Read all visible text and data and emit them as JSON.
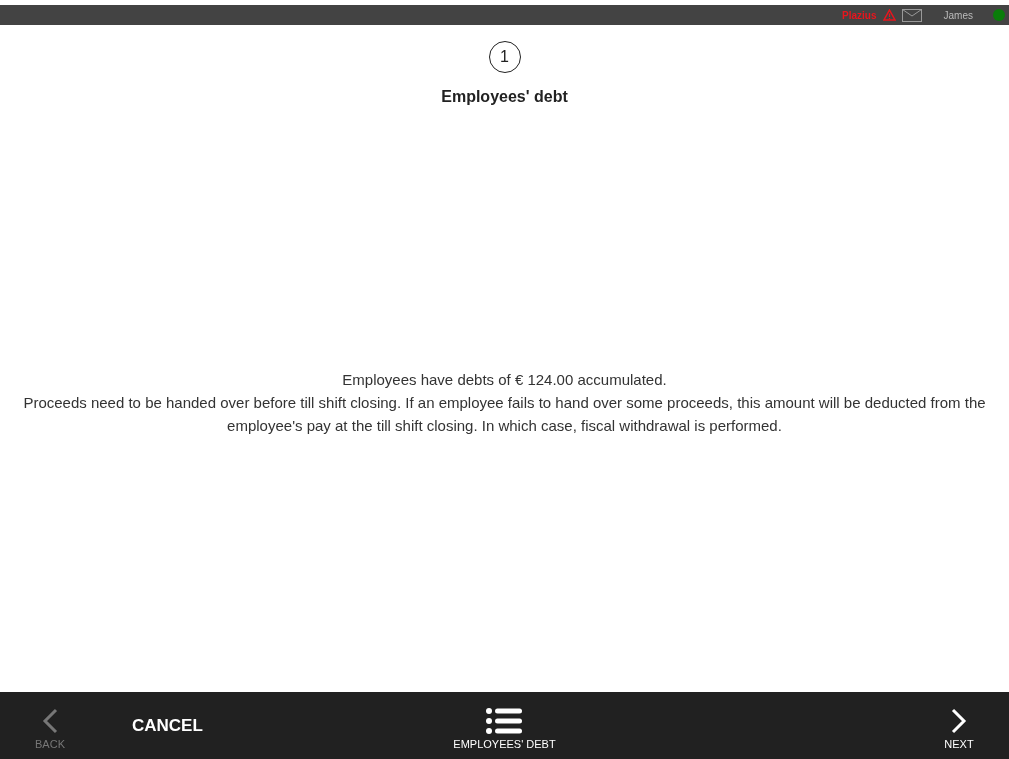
{
  "top_bar": {
    "company": "Plazius",
    "user": "James",
    "online": true
  },
  "step": {
    "number": "1",
    "title": "Employees' debt"
  },
  "message": {
    "summary": "Employees have  debts of € 124.00 accumulated.",
    "details": "Proceeds need to be handed over before till shift closing. If an employee fails to hand over some proceeds, this amount will be deducted from the employee's pay at the till shift closing. In which case, fiscal withdrawal is performed."
  },
  "footer": {
    "back": {
      "label": "BACK",
      "disabled": true
    },
    "cancel": "CANCEL",
    "current_step": "EMPLOYEES' DEBT",
    "next": {
      "label": "NEXT",
      "disabled": false
    }
  }
}
